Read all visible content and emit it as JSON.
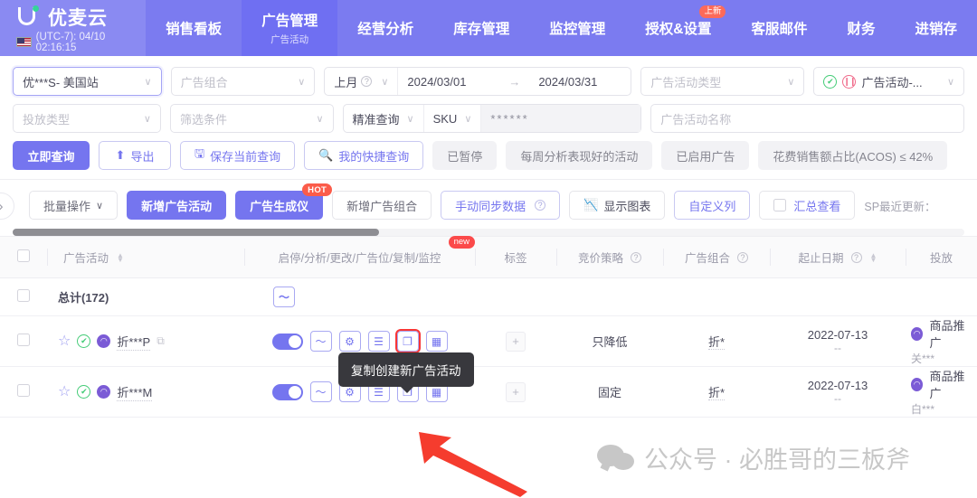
{
  "topnav": {
    "brand_name": "优麦云",
    "timezone_text": "(UTC-7): 04/10 02:16:15",
    "flag_icon": "us-flag-icon",
    "items": [
      {
        "label": "销售看板",
        "sub": "",
        "active": false,
        "badge": ""
      },
      {
        "label": "广告管理",
        "sub": "广告活动",
        "active": true,
        "badge": ""
      },
      {
        "label": "经营分析",
        "sub": "",
        "active": false,
        "badge": ""
      },
      {
        "label": "库存管理",
        "sub": "",
        "active": false,
        "badge": ""
      },
      {
        "label": "监控管理",
        "sub": "",
        "active": false,
        "badge": ""
      },
      {
        "label": "授权&设置",
        "sub": "",
        "active": false,
        "badge": "上新"
      },
      {
        "label": "客服邮件",
        "sub": "",
        "active": false,
        "badge": ""
      },
      {
        "label": "财务",
        "sub": "",
        "active": false,
        "badge": ""
      },
      {
        "label": "进销存",
        "sub": "",
        "active": false,
        "badge": ""
      }
    ]
  },
  "filters": {
    "shop_value": "优***S- 美国站",
    "portfolio_placeholder": "广告组合",
    "date_preset": "上月",
    "date_start": "2024/03/01",
    "date_arrow": "→",
    "date_end": "2024/03/31",
    "campaign_type_placeholder": "广告活动类型",
    "state_value": "广告活动-...",
    "state_check_icon": "circle-check-icon",
    "state_pause_icon": "circle-pause-icon",
    "delivery_type_placeholder": "投放类型",
    "filter_cond_placeholder": "筛选条件",
    "exact_query": "精准查询",
    "sku_label": "SKU",
    "sku_value": "******",
    "campaign_name_placeholder": "广告活动名称"
  },
  "actions": {
    "query_now": "立即查询",
    "export": "导出",
    "save_query": "保存当前查询",
    "my_quick_query": "我的快捷查询",
    "chips": [
      "已暂停",
      "每周分析表现好的活动",
      "已启用广告",
      "花费销售额占比(ACOS) ≤ 42%"
    ]
  },
  "toolbar": {
    "collapse_icon": "chevron-right-icon",
    "bulk_ops": "批量操作",
    "bulk_ops_caret": "∨",
    "new_campaign": "新增广告活动",
    "ad_generator": "广告生成仪",
    "ad_generator_badge": "HOT",
    "new_portfolio": "新增广告组合",
    "manual_sync": "手动同步数据",
    "show_chart": "显示图表",
    "custom_columns": "自定义列",
    "summary_view": "汇总查看",
    "sp_update": "SP最近更新："
  },
  "table": {
    "columns": [
      {
        "label": "广告活动",
        "sortable": true,
        "help": false,
        "badge": ""
      },
      {
        "label": "启停/分析/更改/广告位/复制/监控",
        "sortable": false,
        "help": false,
        "badge": "new"
      },
      {
        "label": "标签",
        "sortable": false,
        "help": false,
        "badge": ""
      },
      {
        "label": "竞价策略",
        "sortable": false,
        "help": true,
        "badge": ""
      },
      {
        "label": "广告组合",
        "sortable": false,
        "help": true,
        "badge": ""
      },
      {
        "label": "起止日期",
        "sortable": true,
        "help": true,
        "badge": ""
      },
      {
        "label": "投放",
        "sortable": false,
        "help": false,
        "badge": ""
      }
    ],
    "total_row": {
      "label": "总计(172)"
    },
    "rows": [
      {
        "name": "折***P",
        "star_icon": "star-icon",
        "status_icon": "circle-check-icon",
        "type_icon": "sp-badge-icon",
        "copy_icon": "copy-small-icon",
        "toggle_on": true,
        "bid_strategy": "只降低",
        "portfolio": "折*",
        "date_start": "2022-07-13",
        "date_end": "--",
        "targeting_type": "商品推广",
        "targeting_sub": "关***"
      },
      {
        "name": "折***M",
        "star_icon": "star-icon",
        "status_icon": "circle-check-icon",
        "type_icon": "sp-badge-icon",
        "copy_icon": "copy-small-icon",
        "toggle_on": true,
        "bid_strategy": "固定",
        "portfolio": "折*",
        "date_start": "2022-07-13",
        "date_end": "--",
        "targeting_type": "商品推广",
        "targeting_sub": "白***"
      }
    ],
    "row_action_icons": [
      "toggle-switch",
      "analytics-icon",
      "gear-icon",
      "edit-placement-icon",
      "copy-campaign-icon",
      "monitor-icon"
    ]
  },
  "tooltip": {
    "text": "复制创建新广告活动"
  },
  "watermark": {
    "text": "公众号 · 必胜哥的三板斧",
    "logo_icon": "wechat-icon"
  },
  "colors": {
    "brand_purple": "#7575ef",
    "nav_bg": "#7b7bf0",
    "nav_active": "#6f6ff2",
    "badge_red": "#fb5c4a",
    "highlight_red": "#f83636",
    "green": "#44cc77"
  }
}
